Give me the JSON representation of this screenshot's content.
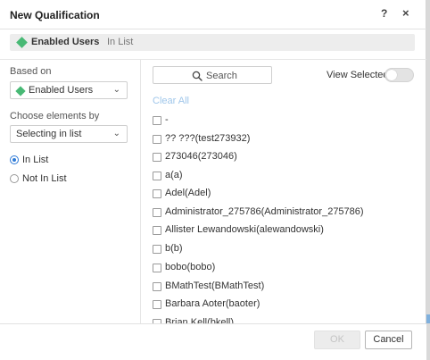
{
  "dialog": {
    "title": "New Qualification",
    "help_label": "?",
    "close_label": "×"
  },
  "summary": {
    "attribute": "Enabled Users",
    "operator": "In List",
    "accent_color": "#48b975"
  },
  "left_panel": {
    "based_on_label": "Based on",
    "based_on_value": "Enabled Users",
    "choose_label": "Choose elements by",
    "choose_value": "Selecting in list",
    "options": [
      {
        "label": "In List",
        "checked": true
      },
      {
        "label": "Not In List",
        "checked": false
      }
    ]
  },
  "right_panel": {
    "search_placeholder": "Search",
    "view_selected_label": "View Selected",
    "view_selected_on": false,
    "clear_all_label": "Clear All",
    "items": [
      {
        "label": "-",
        "checked": false
      },
      {
        "label": "?? ???(test273932)",
        "checked": false
      },
      {
        "label": "273046(273046)",
        "checked": false
      },
      {
        "label": "a(a)",
        "checked": false
      },
      {
        "label": "Adel(Adel)",
        "checked": false
      },
      {
        "label": "Administrator_275786(Administrator_275786)",
        "checked": false
      },
      {
        "label": "Allister Lewandowski(alewandowski)",
        "checked": false
      },
      {
        "label": "b(b)",
        "checked": false
      },
      {
        "label": "bobo(bobo)",
        "checked": false
      },
      {
        "label": "BMathTest(BMathTest)",
        "checked": false
      },
      {
        "label": "Barbara Aoter(baoter)",
        "checked": false
      },
      {
        "label": "Brian Kell(bkell)",
        "checked": false
      }
    ]
  },
  "footer": {
    "ok_label": "OK",
    "cancel_label": "Cancel",
    "ok_enabled": false
  }
}
